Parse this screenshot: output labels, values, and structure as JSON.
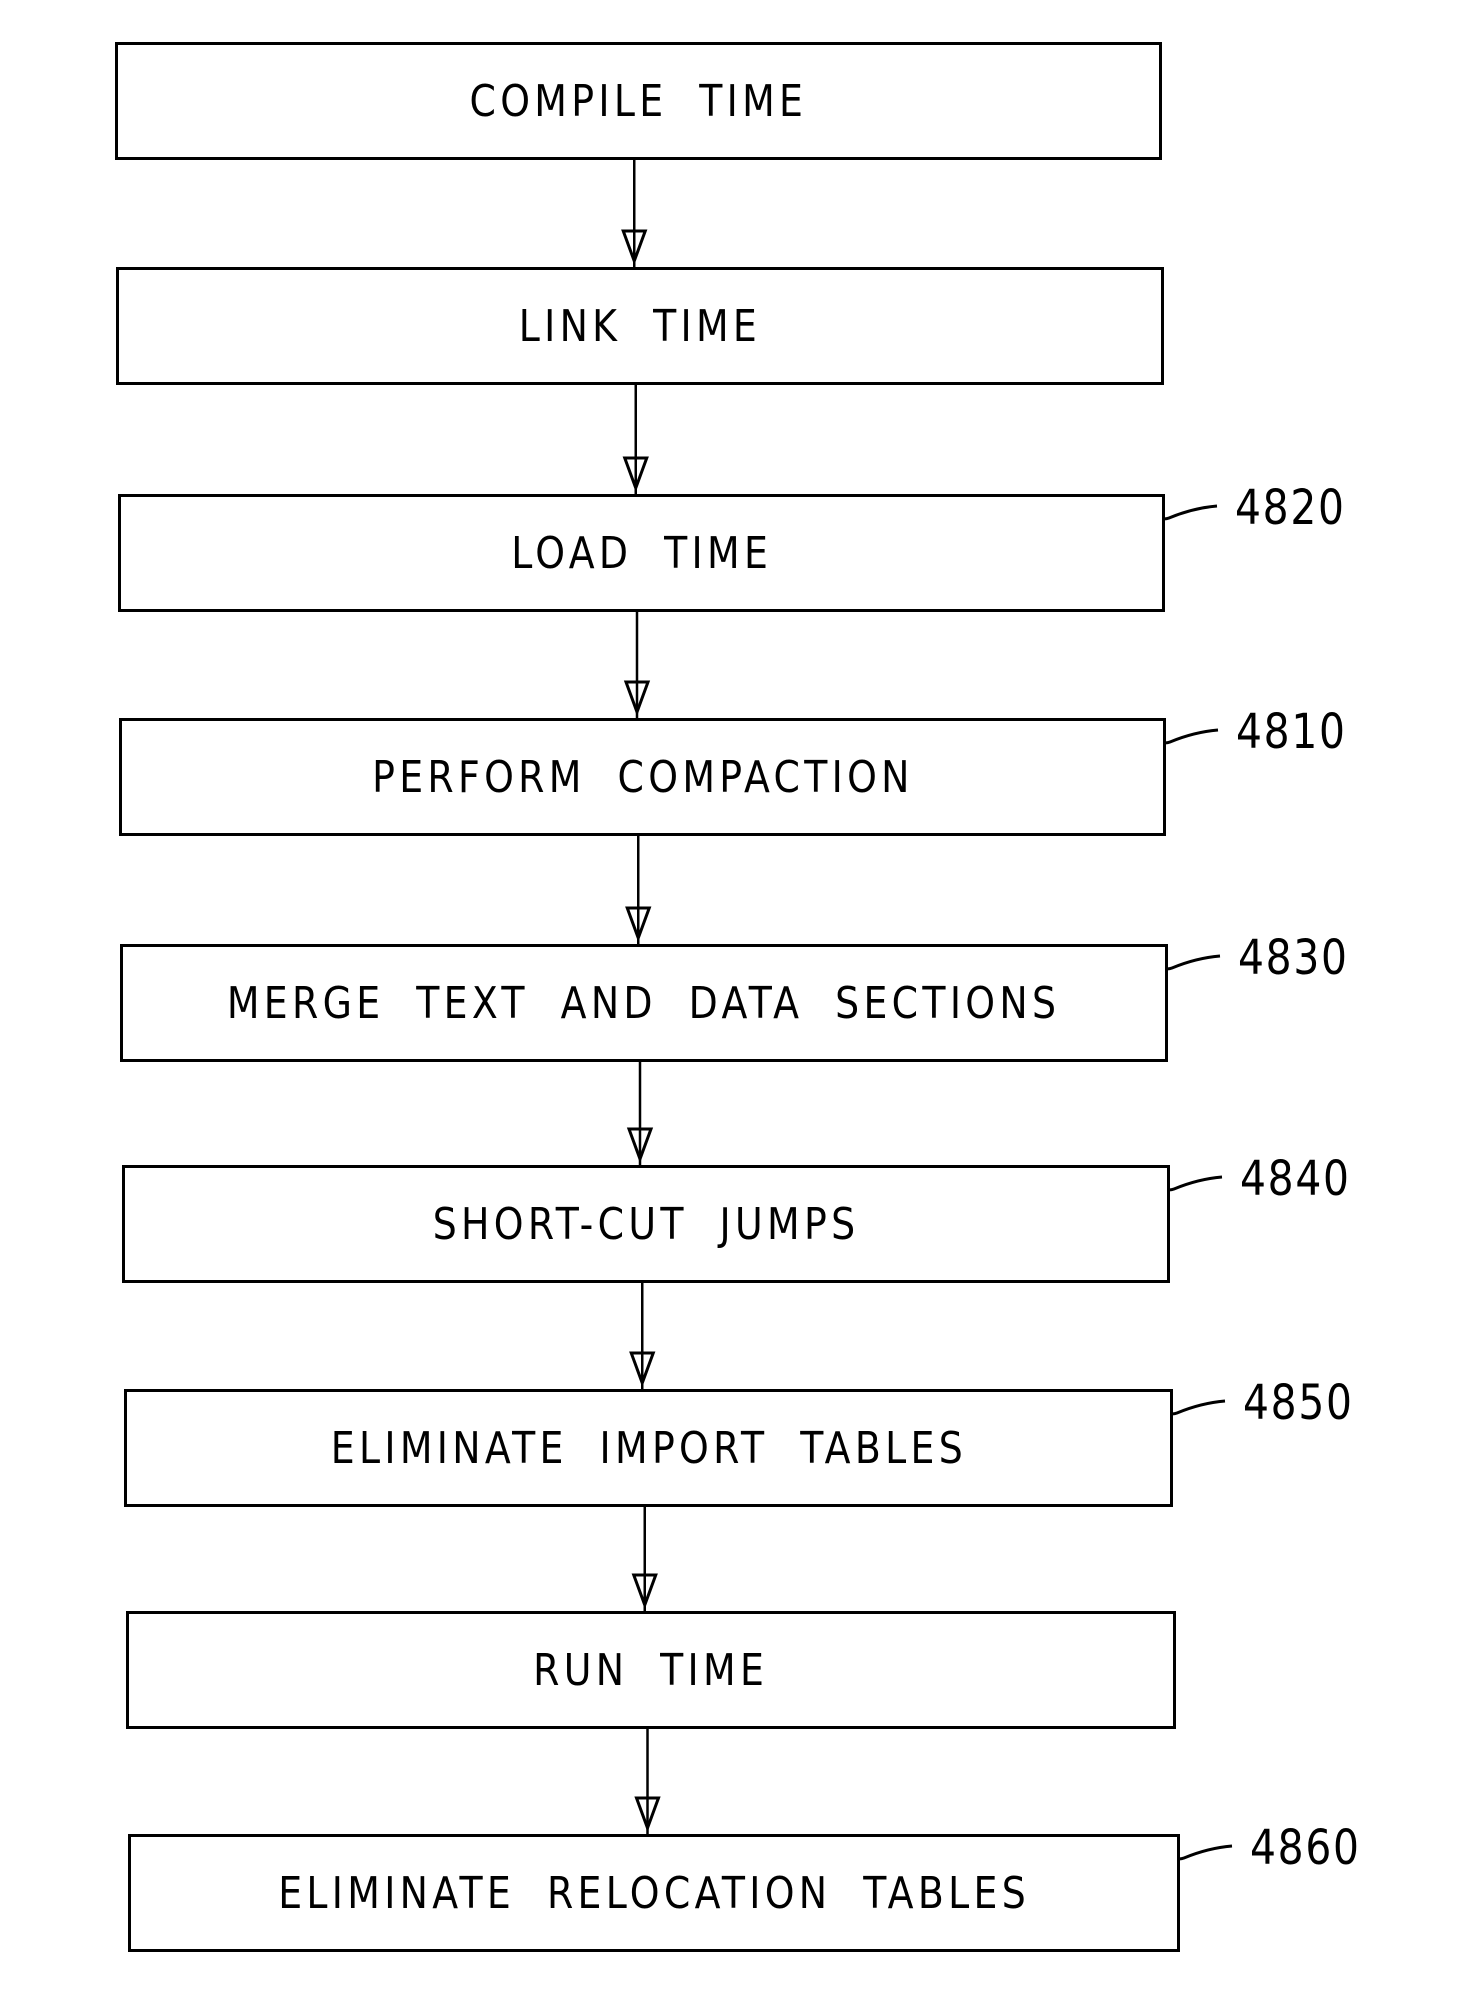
{
  "figure": {
    "type": "flowchart",
    "direction": "top-to-bottom",
    "steps": [
      {
        "id": "compile",
        "label": "COMPILE TIME",
        "ref": null
      },
      {
        "id": "link",
        "label": "LINK TIME",
        "ref": null
      },
      {
        "id": "load",
        "label": "LOAD TIME",
        "ref": "4820"
      },
      {
        "id": "compaction",
        "label": "PERFORM COMPACTION",
        "ref": "4810"
      },
      {
        "id": "merge",
        "label": "MERGE TEXT AND DATA SECTIONS",
        "ref": "4830"
      },
      {
        "id": "shortcut",
        "label": "SHORT-CUT JUMPS",
        "ref": "4840"
      },
      {
        "id": "import",
        "label": "ELIMINATE IMPORT TABLES",
        "ref": "4850"
      },
      {
        "id": "run",
        "label": "RUN TIME",
        "ref": null
      },
      {
        "id": "reloc",
        "label": "ELIMINATE RELOCATION TABLES",
        "ref": "4860"
      }
    ],
    "edges": [
      [
        "compile",
        "link"
      ],
      [
        "link",
        "load"
      ],
      [
        "load",
        "compaction"
      ],
      [
        "compaction",
        "merge"
      ],
      [
        "merge",
        "shortcut"
      ],
      [
        "shortcut",
        "import"
      ],
      [
        "import",
        "run"
      ],
      [
        "run",
        "reloc"
      ]
    ],
    "colors": {
      "stroke": "#000000",
      "background": "#ffffff"
    }
  }
}
